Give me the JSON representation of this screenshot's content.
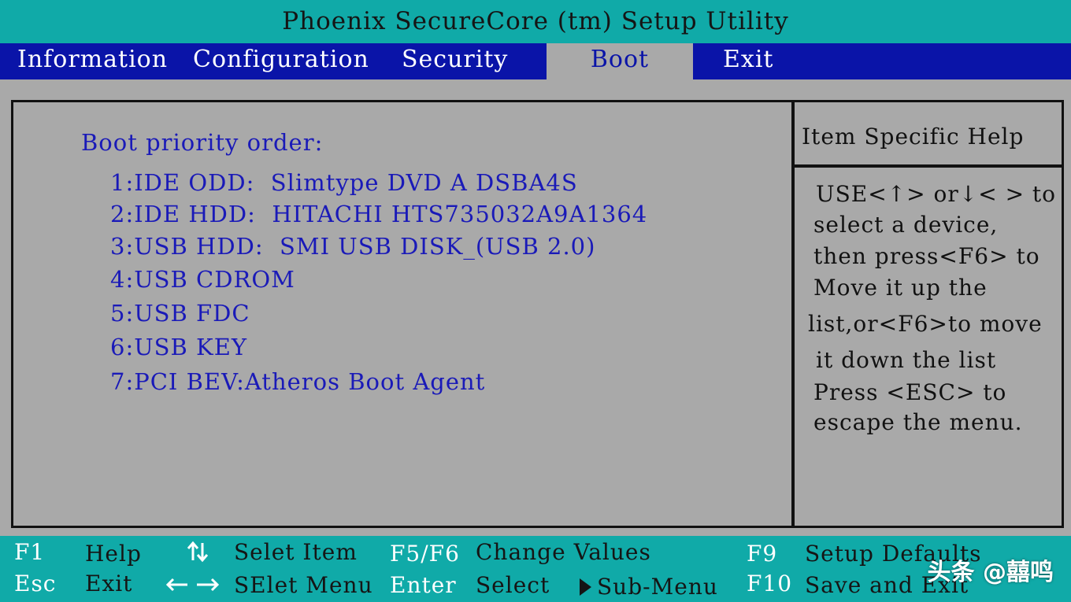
{
  "window": {
    "title": "Phoenix SecureCore (tm)  Setup Utility"
  },
  "menu": {
    "items": [
      {
        "label": "Information",
        "active": false
      },
      {
        "label": "Configuration",
        "active": false
      },
      {
        "label": "Security",
        "active": false
      },
      {
        "label": "Boot",
        "active": true
      },
      {
        "label": "Exit",
        "active": false
      }
    ]
  },
  "boot": {
    "heading": "Boot priority order:",
    "devices": [
      "1:IDE ODD:  Slimtype DVD A DSBA4S",
      "2:IDE HDD:  HITACHI HTS735032A9A1364",
      "3:USB HDD:  SMI USB DISK_(USB 2.0)",
      "4:USB CDROM",
      "5:USB FDC",
      "6:USB KEY",
      "7:PCI BEV:Atheros Boot Agent"
    ]
  },
  "help": {
    "title": "Item Specific Help",
    "lines": [
      "USE<↑> or↓< > to",
      "select a device,",
      "then press<F6> to",
      "Move it up the",
      "list,or<F6>to move",
      "it down the list",
      "Press <ESC> to",
      "escape the menu."
    ]
  },
  "footer": {
    "row1": {
      "key1": "F1",
      "desc1": "Help",
      "icon2": "up-down-arrows-icon",
      "desc2": "Selet Item",
      "key3": "F5/F6",
      "desc3": "Change Values",
      "key4": "F9",
      "desc4": "Setup Defaults"
    },
    "row2": {
      "key1": "Esc",
      "desc1": "Exit",
      "icon2": "left-right-arrows-icon",
      "desc2": "SElet Menu",
      "key3": "Enter",
      "desc3": "Select",
      "icon3": "right-triangle-icon",
      "desc3b": "Sub-Menu",
      "key4": "F10",
      "desc4": "Save and Exit"
    }
  },
  "watermark": "头条 @囍鸣",
  "colors": {
    "title_bg": "#10aaa8",
    "menu_bg": "#0a14a8",
    "panel_bg": "#a9a9a9",
    "text_blue": "#1a1ab8",
    "text_white": "#ffffff",
    "border": "#111111"
  }
}
